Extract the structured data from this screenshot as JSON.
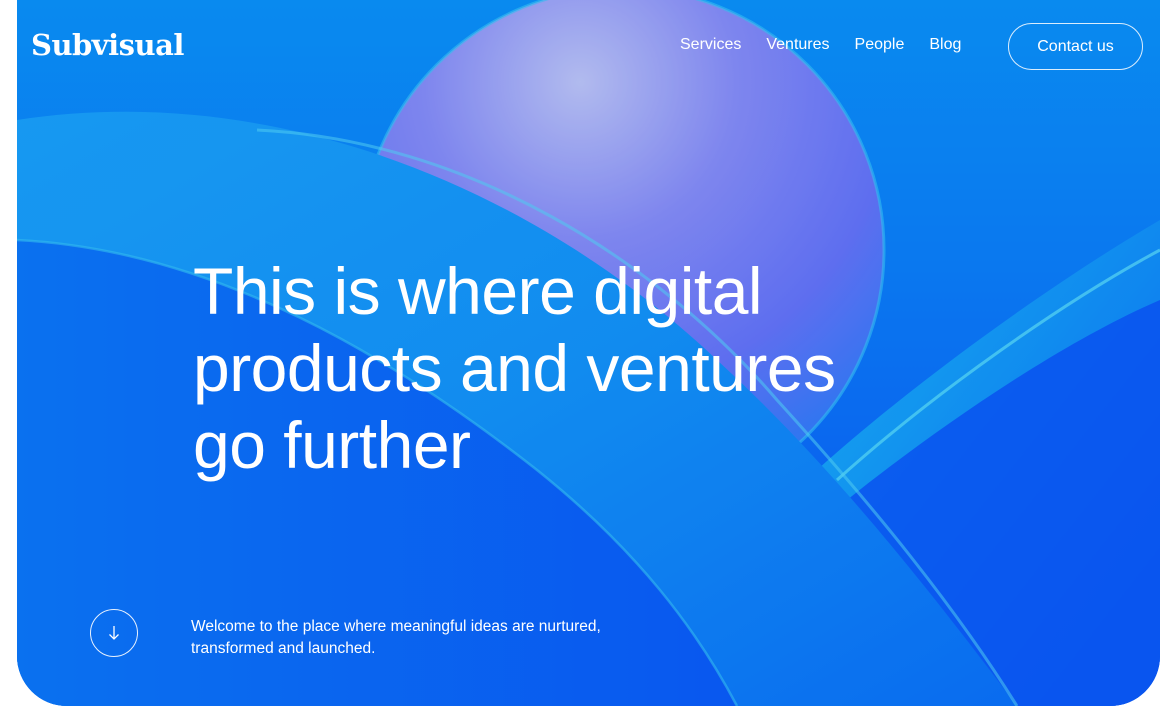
{
  "brand": {
    "name": "Subvisual"
  },
  "nav": {
    "items": [
      "Services",
      "Ventures",
      "People",
      "Blog"
    ],
    "contact_label": "Contact us"
  },
  "hero": {
    "headline_lines": [
      "This is where digital",
      "products and ventures",
      "go further"
    ],
    "tagline_lines": [
      "Welcome to the place where meaningful ideas are nurtured,",
      "transformed and launched."
    ]
  },
  "icons": {
    "scroll": "arrow-down-icon"
  },
  "colors": {
    "background_top": "#0a8ff0",
    "background_bottom": "#0a4ef0",
    "sphere": "#8a7fe6",
    "text": "#ffffff"
  }
}
